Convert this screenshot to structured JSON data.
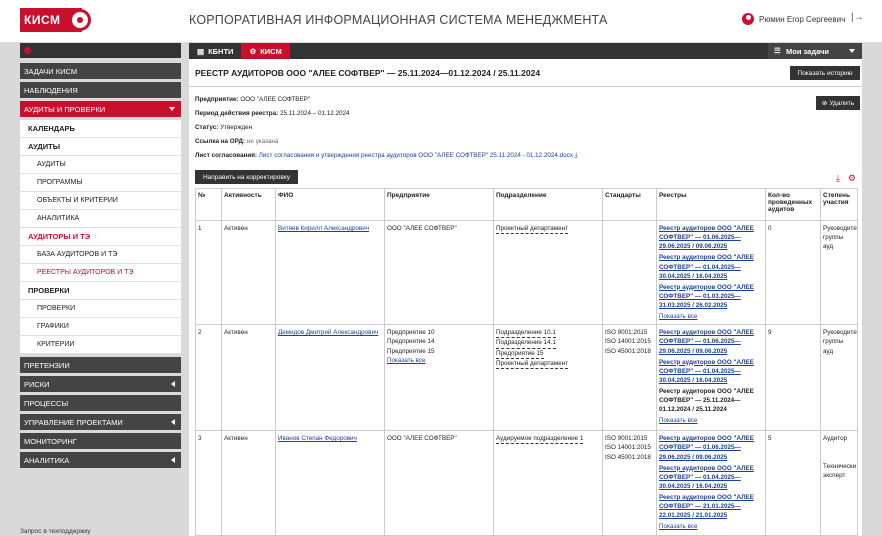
{
  "header": {
    "logo_text": "КИСМ",
    "app_title": "КОРПОРАТИВНАЯ ИНФОРМАЦИОННАЯ СИСТЕМА МЕНЕДЖМЕНТА",
    "user_name": "Рюмин Егор Сергеевич",
    "logout_icon": "logout-icon"
  },
  "sidebar": {
    "sections": [
      {
        "label": "ЗАДАЧИ КИСМ"
      },
      {
        "label": "НАБЛЮДЕНИЯ"
      },
      {
        "label": "АУДИТЫ И ПРОВЕРКИ"
      }
    ],
    "audit_items": [
      {
        "label": "КАЛЕНДАРЬ"
      },
      {
        "label": "АУДИТЫ"
      },
      {
        "label": "АУДИТЫ"
      },
      {
        "label": "ПРОГРАММЫ"
      },
      {
        "label": "ОБЪЕКТЫ И КРИТЕРИИ"
      },
      {
        "label": "АНАЛИТИКА"
      },
      {
        "label": "АУДИТОРЫ И ТЭ"
      },
      {
        "label": "БАЗА АУДИТОРОВ И ТЭ"
      },
      {
        "label": "РЕЕСТРЫ АУДИТОРОВ И ТЭ"
      },
      {
        "label": "ПРОВЕРКИ"
      },
      {
        "label": "ПРОВЕРКИ"
      },
      {
        "label": "ГРАФИКИ"
      },
      {
        "label": "КРИТЕРИИ"
      }
    ],
    "bottom_sections": [
      {
        "label": "ПРЕТЕНЗИИ"
      },
      {
        "label": "РИСКИ"
      },
      {
        "label": "ПРОЦЕССЫ"
      },
      {
        "label": "УПРАВЛЕНИЕ ПРОЕКТАМИ"
      },
      {
        "label": "МОНИТОРИНГ"
      },
      {
        "label": "АНАЛИТИКА"
      }
    ],
    "support": "Запрос в техподдержку"
  },
  "tabs": [
    {
      "label": "КБНТИ"
    },
    {
      "label": "КИСМ"
    }
  ],
  "my_tasks": "Мои задачи",
  "page": {
    "title": "РЕЕСТР АУДИТОРОВ ООО \"АЛЕЕ СОФТВЕР\" — 25.11.2024—01.12.2024 / 25.11.2024",
    "show_history": "Показать историю",
    "delete": "Удалить",
    "enterprise_label": "Предприятие:",
    "enterprise_value": "ООО \"АЛЕЕ СОФТВЕР\"",
    "period_label": "Период действия реестра:",
    "period_value": "25.11.2024 – 01.12.2024",
    "status_label": "Статус:",
    "status_value": "Утвержден",
    "ord_label": "Ссылка на ОРД:",
    "ord_value": "не указана",
    "sheet_label": "Лист согласования:",
    "sheet_value": "Лист согласования и утверждения реестра аудиторов ООО \"АЛЕЕ СОФТВЕР\" 25.11.2024 - 01.12.2024.docx",
    "send_correction": "Направить на корректировку"
  },
  "table": {
    "headers": [
      "№",
      "Активность",
      "ФИО",
      "Предприятие",
      "Подразделение",
      "Стандарты",
      "Реестры",
      "Кол-во проведенных аудитов",
      "Степень участия"
    ],
    "show_all": "Показать все",
    "rows": [
      {
        "num": "1",
        "activity": "Активен",
        "fio": "Витяев Кирилл Александрович",
        "enterprises": [
          "ООО \"АЛЕЕ СОФТВЕР\""
        ],
        "departments": [
          "Проектный департамент"
        ],
        "standards": [],
        "registries": [
          "Реестр аудиторов ООО \"АЛЕЕ СОФТВЕР\" — 01.06.2025—29.06.2025 / 09.06.2025",
          "Реестр аудиторов ООО \"АЛЕЕ СОФТВЕР\" — 01.04.2025—30.04.2025 / 16.04.2025",
          "Реестр аудиторов ООО \"АЛЕЕ СОФТВЕР\" — 01.03.2025—31.03.2025 / 26.02.2025"
        ],
        "registries_current": "",
        "count": "0",
        "participation": [
          "Руководите",
          "группы ауд"
        ]
      },
      {
        "num": "2",
        "activity": "Активен",
        "fio": "Демидов Дмитрий Александрович",
        "enterprises": [
          "Предприятие 10",
          "Предприятие 14",
          "Предприятие 15"
        ],
        "departments": [
          "Подразделение 10.1",
          "Подразделение 14.1",
          "Предприятие 15",
          "Проектный департамент"
        ],
        "standards": [
          "ISO 9001:2015",
          "ISO 14001:2015",
          "ISO 45001:2018"
        ],
        "registries": [
          "Реестр аудиторов ООО \"АЛЕЕ СОФТВЕР\" — 01.06.2025—29.06.2025 / 09.06.2025",
          "Реестр аудиторов ООО \"АЛЕЕ СОФТВЕР\" — 01.04.2025—30.04.2025 / 16.04.2025"
        ],
        "registries_current": "Реестр аудиторов ООО \"АЛЕЕ СОФТВЕР\" — 25.11.2024—01.12.2024 / 25.11.2024",
        "count": "9",
        "participation": [
          "Руководите",
          "группы ауд"
        ]
      },
      {
        "num": "3",
        "activity": "Активен",
        "fio": "Иванов Степан Федорович",
        "enterprises": [
          "ООО \"АЛЕЕ СОФТВЕР\""
        ],
        "departments": [
          "Аудируемое подразделение 1"
        ],
        "standards": [
          "ISO 9001:2015",
          "ISO 14001:2015",
          "ISO 45001:2018"
        ],
        "registries": [
          "Реестр аудиторов ООО \"АЛЕЕ СОФТВЕР\" — 01.06.2025—29.06.2025 / 09.06.2025",
          "Реестр аудиторов ООО \"АЛЕЕ СОФТВЕР\" — 01.04.2025—30.04.2025 / 16.04.2025",
          "Реестр аудиторов ООО \"АЛЕЕ СОФТВЕР\" — 21.01.2025—22.01.2025 / 21.01.2025"
        ],
        "registries_current": "",
        "count": "5",
        "participation": [
          "Аудитор",
          "",
          "",
          "Технически",
          "эксперт"
        ]
      }
    ]
  },
  "colors": {
    "accent": "#c8102e",
    "dark": "#333333"
  }
}
